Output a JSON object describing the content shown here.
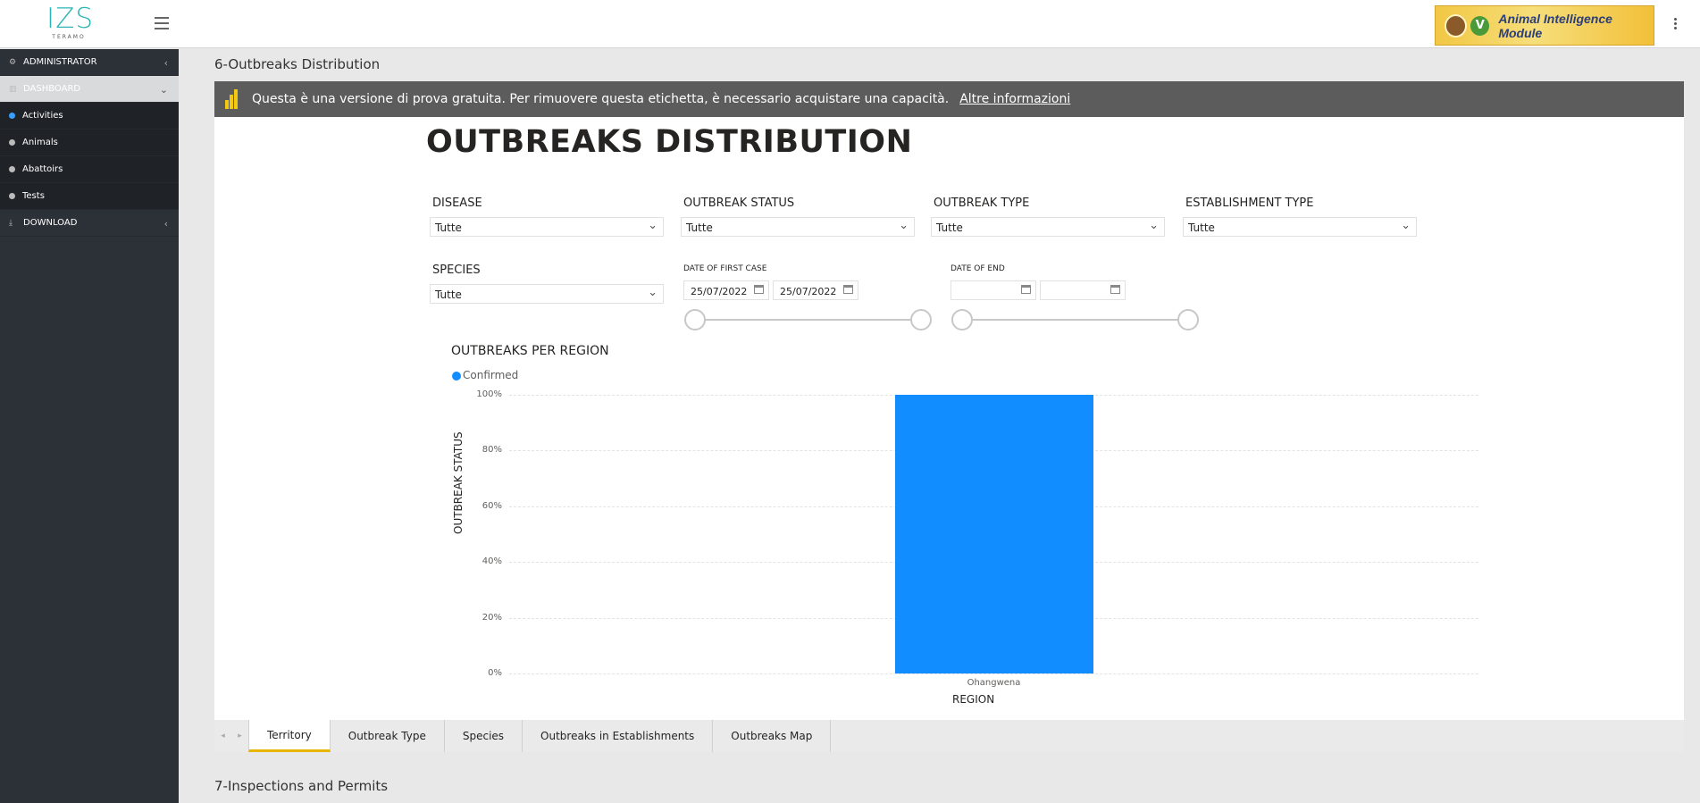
{
  "topbar": {
    "logo_text": "IZS",
    "logo_sub": "TERAMO",
    "banner_text": "Animal Intelligence Module",
    "banner_v": "V"
  },
  "sidebar": {
    "items": [
      {
        "label": "ADMINISTRATOR",
        "icon": "users-cog-icon"
      },
      {
        "label": "DASHBOARD",
        "icon": "bar-chart-icon"
      },
      {
        "label": "DOWNLOAD",
        "icon": "download-icon"
      }
    ],
    "subitems": [
      {
        "label": "Activities"
      },
      {
        "label": "Animals"
      },
      {
        "label": "Abattoirs"
      },
      {
        "label": "Tests"
      }
    ]
  },
  "sections": {
    "s6": "6-Outbreaks Distribution",
    "s7": "7-Inspections and Permits"
  },
  "trial": {
    "text": "Questa è una versione di prova gratuita. Per rimuovere questa etichetta, è necessario acquistare una capacità.",
    "link": "Altre informazioni"
  },
  "report": {
    "title": "OUTBREAKS DISTRIBUTION",
    "slicers": {
      "disease": {
        "label": "DISEASE",
        "value": "Tutte"
      },
      "outbreak_status": {
        "label": "OUTBREAK STATUS",
        "value": "Tutte"
      },
      "outbreak_type": {
        "label": "OUTBREAK TYPE",
        "value": "Tutte"
      },
      "establishment_type": {
        "label": "ESTABLISHMENT TYPE",
        "value": "Tutte"
      },
      "species": {
        "label": "SPECIES",
        "value": "Tutte"
      },
      "date_first_case": {
        "label": "DATE OF FIRST CASE",
        "from": "25/07/2022",
        "to": "25/07/2022"
      },
      "date_end": {
        "label": "DATE OF END",
        "from": "",
        "to": ""
      }
    }
  },
  "chart_data": {
    "type": "bar",
    "title": "OUTBREAKS PER REGION",
    "xlabel": "REGION",
    "ylabel": "OUTBREAK STATUS",
    "categories": [
      "Ohangwena"
    ],
    "series": [
      {
        "name": "Confirmed",
        "values": [
          100
        ]
      }
    ],
    "yticks": [
      "0%",
      "20%",
      "40%",
      "60%",
      "80%",
      "100%"
    ],
    "ylim": [
      0,
      100
    ],
    "color": "#118dff",
    "grid": true,
    "legend": "top-left"
  },
  "tabs": [
    "Territory",
    "Outbreak Type",
    "Species",
    "Outbreaks in Establishments",
    "Outbreaks Map"
  ]
}
